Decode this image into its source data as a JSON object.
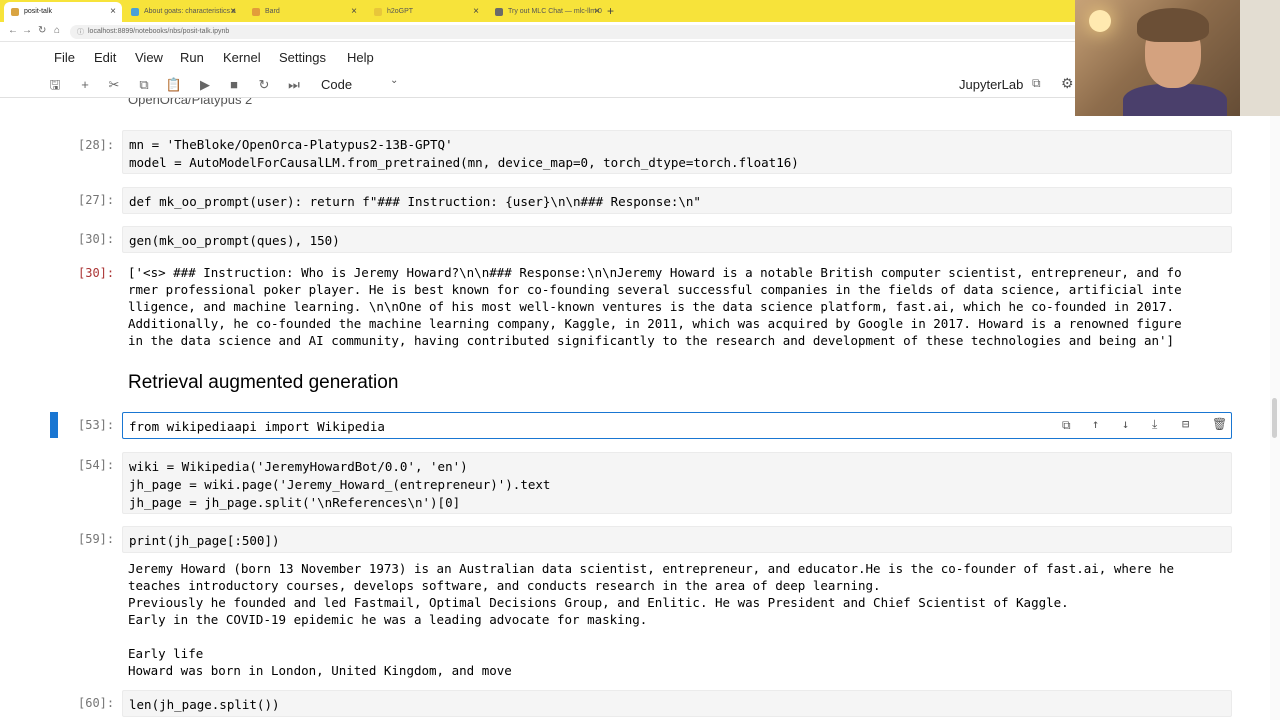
{
  "browser": {
    "tabs": [
      {
        "label": "posit-talk"
      },
      {
        "label": "About goats: characteristics a"
      },
      {
        "label": "Bard"
      },
      {
        "label": "h2oGPT"
      },
      {
        "label": "Try out MLC Chat — mlc-llm 0"
      }
    ],
    "url": "localhost:8899/notebooks/nbs/posit-talk.ipynb"
  },
  "menu": [
    "File",
    "Edit",
    "View",
    "Run",
    "Kernel",
    "Settings",
    "Help"
  ],
  "toolbar": {
    "cell_type": "Code",
    "brand": "JupyterLab"
  },
  "notebook": {
    "truncated_heading": "OpenOrca/Platypus 2",
    "cells": [
      {
        "prompt": "[28]:",
        "code_line1": "mn = 'TheBloke/OpenOrca-Platypus2-13B-GPTQ'",
        "code_line2": "model = AutoModelForCausalLM.from_pretrained(mn, device_map=0, torch_dtype=torch.float16)"
      },
      {
        "prompt": "[27]:",
        "code": "def mk_oo_prompt(user): return f\"### Instruction: {user}\\n\\n### Response:\\n\""
      },
      {
        "prompt": "[30]:",
        "code": "gen(mk_oo_prompt(ques), 150)"
      },
      {
        "prompt": "[30]:",
        "output_lines": [
          "['<s> ### Instruction: Who is Jeremy Howard?\\n\\n### Response:\\n\\nJeremy Howard is a notable British computer scientist, entrepreneur, and fo",
          "rmer professional poker player. He is best known for co-founding several successful companies in the fields of data science, artificial inte",
          "lligence, and machine learning. \\n\\nOne of his most well-known ventures is the data science platform, fast.ai, which he co-founded in 2017.",
          "Additionally, he co-founded the machine learning company, Kaggle, in 2011, which was acquired by Google in 2017. Howard is a renowned figure",
          "in the data science and AI community, having contributed significantly to the research and development of these technologies and being an']"
        ]
      },
      {
        "heading": "Retrieval augmented generation"
      },
      {
        "prompt": "[53]:",
        "code": "from wikipediaapi import Wikipedia"
      },
      {
        "prompt": "[54]:",
        "code_lines": [
          "wiki = Wikipedia('JeremyHowardBot/0.0', 'en')",
          "jh_page = wiki.page('Jeremy_Howard_(entrepreneur)').text",
          "jh_page = jh_page.split('\\nReferences\\n')[0]"
        ]
      },
      {
        "prompt": "[59]:",
        "code": "print(jh_page[:500])",
        "output_lines": [
          "Jeremy Howard (born 13 November 1973) is an Australian data scientist, entrepreneur, and educator.He is the co-founder of fast.ai, where he",
          "teaches introductory courses, develops software, and conducts research in the area of deep learning.",
          "Previously he founded and led Fastmail, Optimal Decisions Group, and Enlitic. He was President and Chief Scientist of Kaggle.",
          "Early in the COVID-19 epidemic he was a leading advocate for masking.",
          "",
          "Early life",
          "Howard was born in London, United Kingdom, and move"
        ]
      },
      {
        "prompt": "[60]:",
        "code": "len(jh_page.split())"
      }
    ]
  }
}
